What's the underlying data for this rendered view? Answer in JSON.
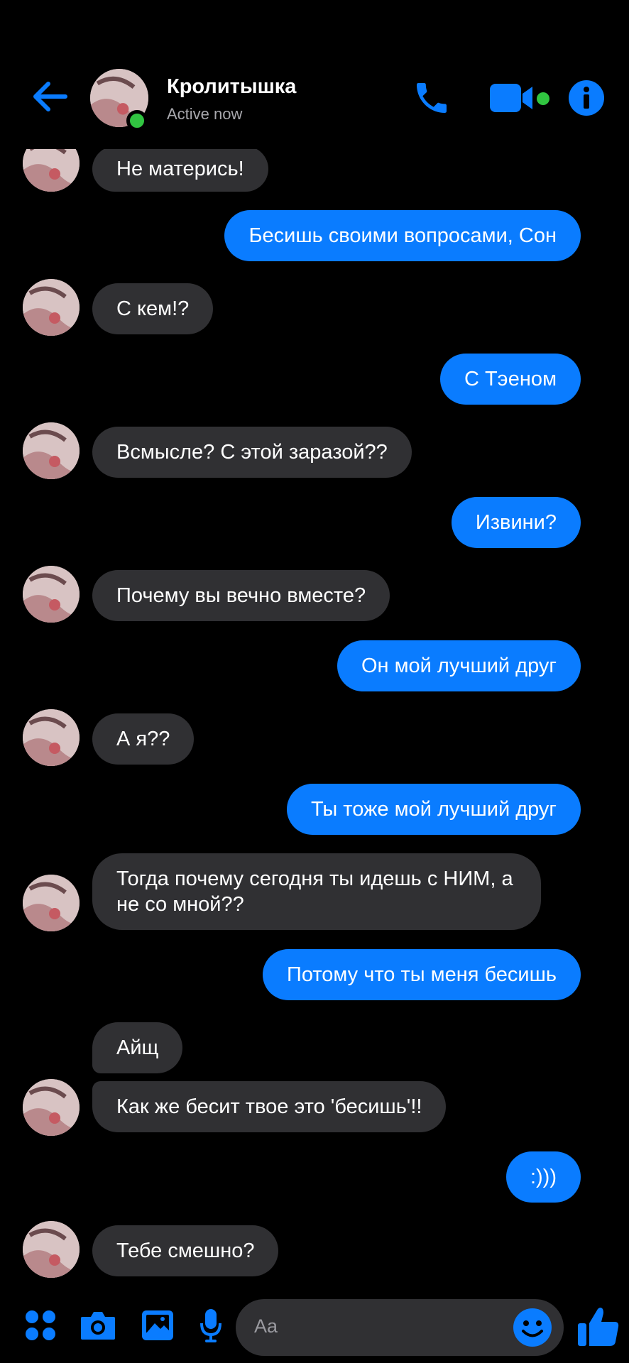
{
  "header": {
    "name": "Кролитышка",
    "status": "Active now"
  },
  "messages": [
    {
      "side": "in",
      "text": "Не матерись!"
    },
    {
      "side": "out",
      "text": "Бесишь своими вопросами, Сон"
    },
    {
      "side": "in",
      "text": "С кем!?"
    },
    {
      "side": "out",
      "text": "С Тэеном"
    },
    {
      "side": "in",
      "text": "Всмысле? С этой заразой??"
    },
    {
      "side": "out",
      "text": "Извини?"
    },
    {
      "side": "in",
      "text": "Почему вы вечно вместе?"
    },
    {
      "side": "out",
      "text": "Он мой лучший друг"
    },
    {
      "side": "in",
      "text": "А я??"
    },
    {
      "side": "out",
      "text": "Ты тоже мой лучший друг"
    },
    {
      "side": "in",
      "text": "Тогда почему сегодня ты идешь с НИМ, а не со мной??"
    },
    {
      "side": "out",
      "text": "Потому что ты меня бесишь"
    },
    {
      "side": "in",
      "text": "Айщ"
    },
    {
      "side": "in",
      "text": "Как же бесит твое это 'бесишь'!!"
    },
    {
      "side": "out",
      "text": ":)))"
    },
    {
      "side": "in",
      "text": "Тебе смешно?"
    }
  ],
  "composer": {
    "placeholder": "Aa"
  },
  "colors": {
    "accent": "#0a7cff",
    "incoming_bubble": "#303033",
    "online": "#31c541",
    "background": "#000000"
  },
  "icons": [
    "back-arrow-icon",
    "phone-icon",
    "video-camera-icon",
    "info-icon",
    "apps-grid-icon",
    "camera-icon",
    "gallery-icon",
    "microphone-icon",
    "emoji-icon",
    "thumbs-up-icon"
  ]
}
